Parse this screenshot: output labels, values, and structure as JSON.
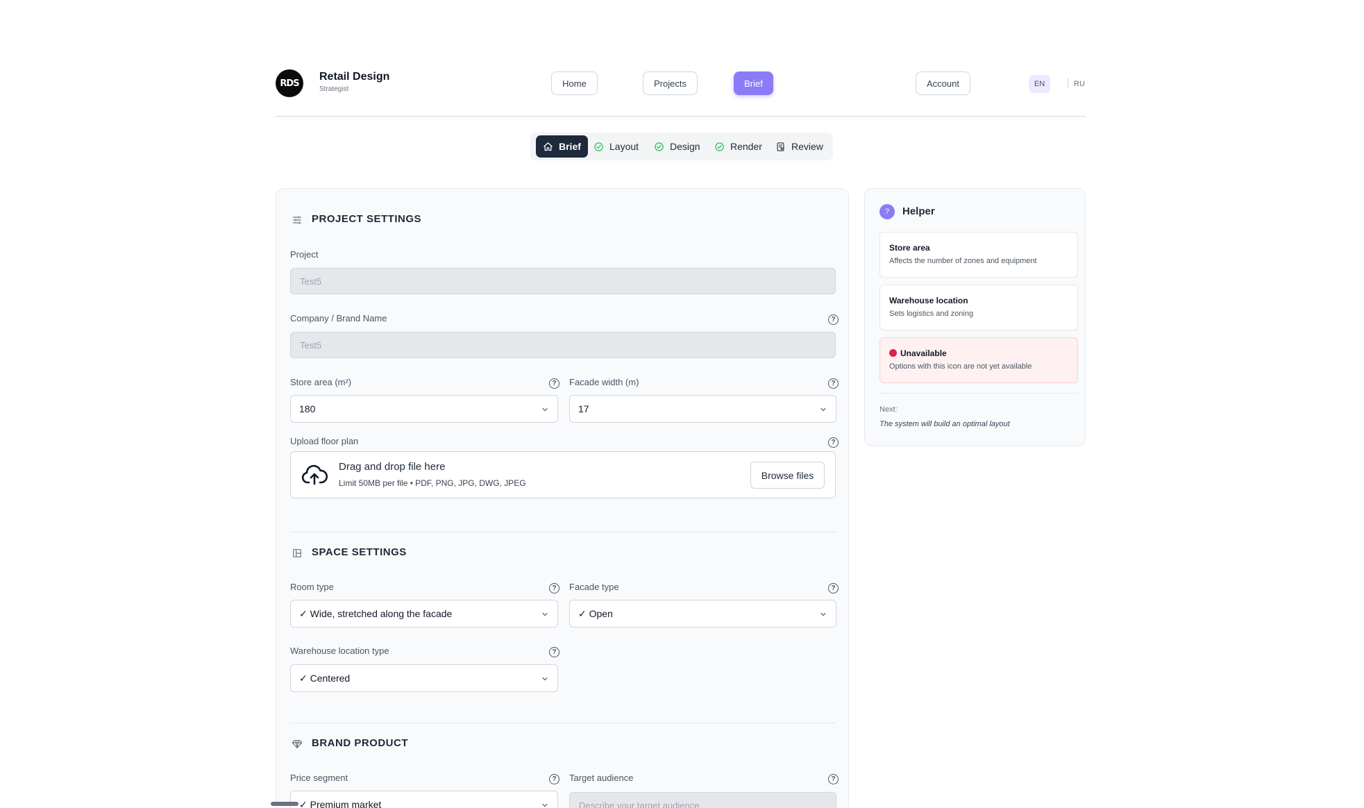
{
  "header": {
    "logo_text": "RDS",
    "brand_title": "Retail Design",
    "brand_subtitle": "Strategist",
    "nav": {
      "home": "Home",
      "projects": "Projects",
      "brief": "Brief",
      "account": "Account"
    },
    "languages": [
      "EN",
      "RU"
    ],
    "active_language": "EN",
    "accent_color": "#8b7cf6"
  },
  "stepper": {
    "steps": [
      {
        "label": "Brief",
        "state": "active",
        "icon": "home-icon"
      },
      {
        "label": "Layout",
        "state": "done",
        "icon": "check-circle-icon"
      },
      {
        "label": "Design",
        "state": "done",
        "icon": "check-circle-icon"
      },
      {
        "label": "Render",
        "state": "done",
        "icon": "check-circle-icon"
      },
      {
        "label": "Review",
        "state": "pending",
        "icon": "document-icon"
      }
    ]
  },
  "project_settings": {
    "title": "PROJECT SETTINGS",
    "project_label": "Project",
    "project_value": "Test5",
    "company_label": "Company / Brand Name",
    "company_value": "Test5",
    "store_area_label": "Store area (m²)",
    "store_area_value": "180",
    "facade_width_label": "Facade width (m)",
    "facade_width_value": "17",
    "upload_label": "Upload floor plan",
    "upload_title": "Drag and drop file here",
    "upload_hint": "Limit 50MB per file • PDF, PNG, JPG, DWG, JPEG",
    "browse_label": "Browse files"
  },
  "space_settings": {
    "title": "SPACE SETTINGS",
    "room_type_label": "Room type",
    "room_type_value": "✓ Wide, stretched along the facade",
    "facade_type_label": "Facade type",
    "facade_type_value": "✓ Open",
    "warehouse_label": "Warehouse location type",
    "warehouse_value": "✓ Centered"
  },
  "brand_product": {
    "title": "BRAND PRODUCT",
    "price_segment_label": "Price segment",
    "price_segment_value": "✓ Premium market",
    "target_audience_label": "Target audience",
    "target_audience_placeholder": "Describe your target audience"
  },
  "helper": {
    "badge": "?",
    "title": "Helper",
    "cards": [
      {
        "title": "Store area",
        "text": "Affects the number of zones and equipment"
      },
      {
        "title": "Warehouse location",
        "text": "Sets logistics and zoning"
      },
      {
        "title": "Unavailable",
        "text": "Options with this icon are not yet available"
      }
    ],
    "next_label": "Next:",
    "next_text": "The system will build an optimal layout"
  }
}
